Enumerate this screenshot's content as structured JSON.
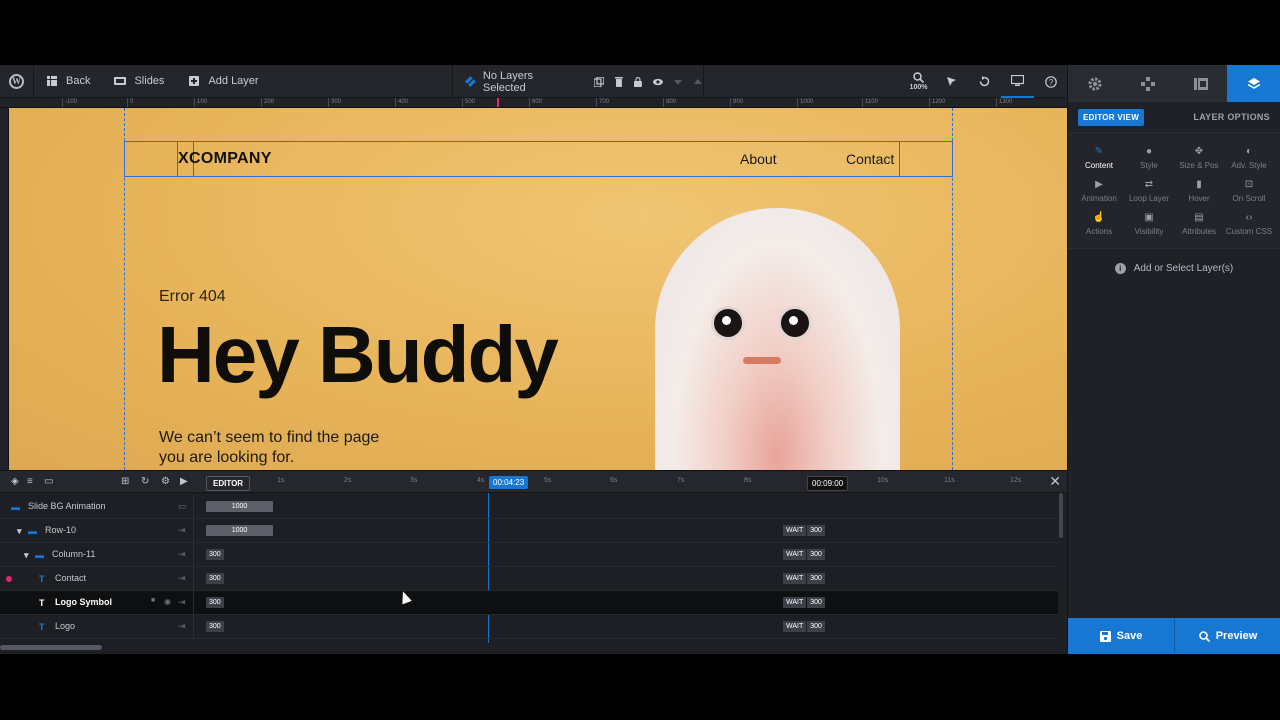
{
  "toolbar": {
    "back_label": "Back",
    "slides_label": "Slides",
    "add_layer_label": "Add Layer",
    "selection_status": "No Layers Selected",
    "zoom": "100%"
  },
  "ruler": {
    "ticks": [
      "-100",
      "0",
      "100",
      "200",
      "300",
      "400",
      "500",
      "600",
      "700",
      "800",
      "900",
      "1000",
      "1100",
      "1200",
      "1300"
    ]
  },
  "canvas": {
    "logo_text": "XCOMPANY",
    "nav_about": "About",
    "nav_contact": "Contact",
    "error_label": "Error 404",
    "headline": "Hey Buddy",
    "subtext_line1": "We can’t seem to find the page",
    "subtext_line2": "you are looking for."
  },
  "panel": {
    "editor_view_label": "EDITOR VIEW",
    "layer_options_title": "LAYER OPTIONS",
    "options": [
      {
        "label": "Content",
        "icon": "pencil-icon"
      },
      {
        "label": "Style",
        "icon": "palette-icon"
      },
      {
        "label": "Size & Pos",
        "icon": "move-icon"
      },
      {
        "label": "Adv. Style",
        "icon": "contrast-icon"
      },
      {
        "label": "Animation",
        "icon": "play-icon"
      },
      {
        "label": "Loop Layer",
        "icon": "loop-icon"
      },
      {
        "label": "Hover",
        "icon": "mouse-icon"
      },
      {
        "label": "On Scroll",
        "icon": "scroll-icon"
      },
      {
        "label": "Actions",
        "icon": "hand-icon"
      },
      {
        "label": "Visibility",
        "icon": "visibility-icon"
      },
      {
        "label": "Attributes",
        "icon": "document-icon"
      },
      {
        "label": "Custom CSS",
        "icon": "code-icon"
      }
    ],
    "hint": "Add or Select Layer(s)",
    "save_label": "Save",
    "preview_label": "Preview"
  },
  "timeline": {
    "editor_tag": "EDITOR",
    "current_time": "00:04:23",
    "end_time": "00:09:00",
    "seconds": [
      "1s",
      "2s",
      "3s",
      "4s",
      "5s",
      "6s",
      "7s",
      "8s",
      "9s",
      "10s",
      "11s",
      "12s"
    ],
    "wait_label": "WAIT",
    "layers": [
      {
        "name": "Slide BG Animation",
        "duration": "1000",
        "wait": ""
      },
      {
        "name": "Row-10",
        "duration": "1000",
        "wait": "300"
      },
      {
        "name": "Column-11",
        "duration": "300",
        "wait": "300"
      },
      {
        "name": "Contact",
        "duration": "300",
        "wait": "300"
      },
      {
        "name": "Logo Symbol",
        "duration": "300",
        "wait": "300"
      },
      {
        "name": "Logo",
        "duration": "300",
        "wait": "300"
      }
    ]
  },
  "colors": {
    "accent": "#1778d3",
    "canvas_bg": "#e7b45a",
    "panel_bg": "#1f2126"
  }
}
